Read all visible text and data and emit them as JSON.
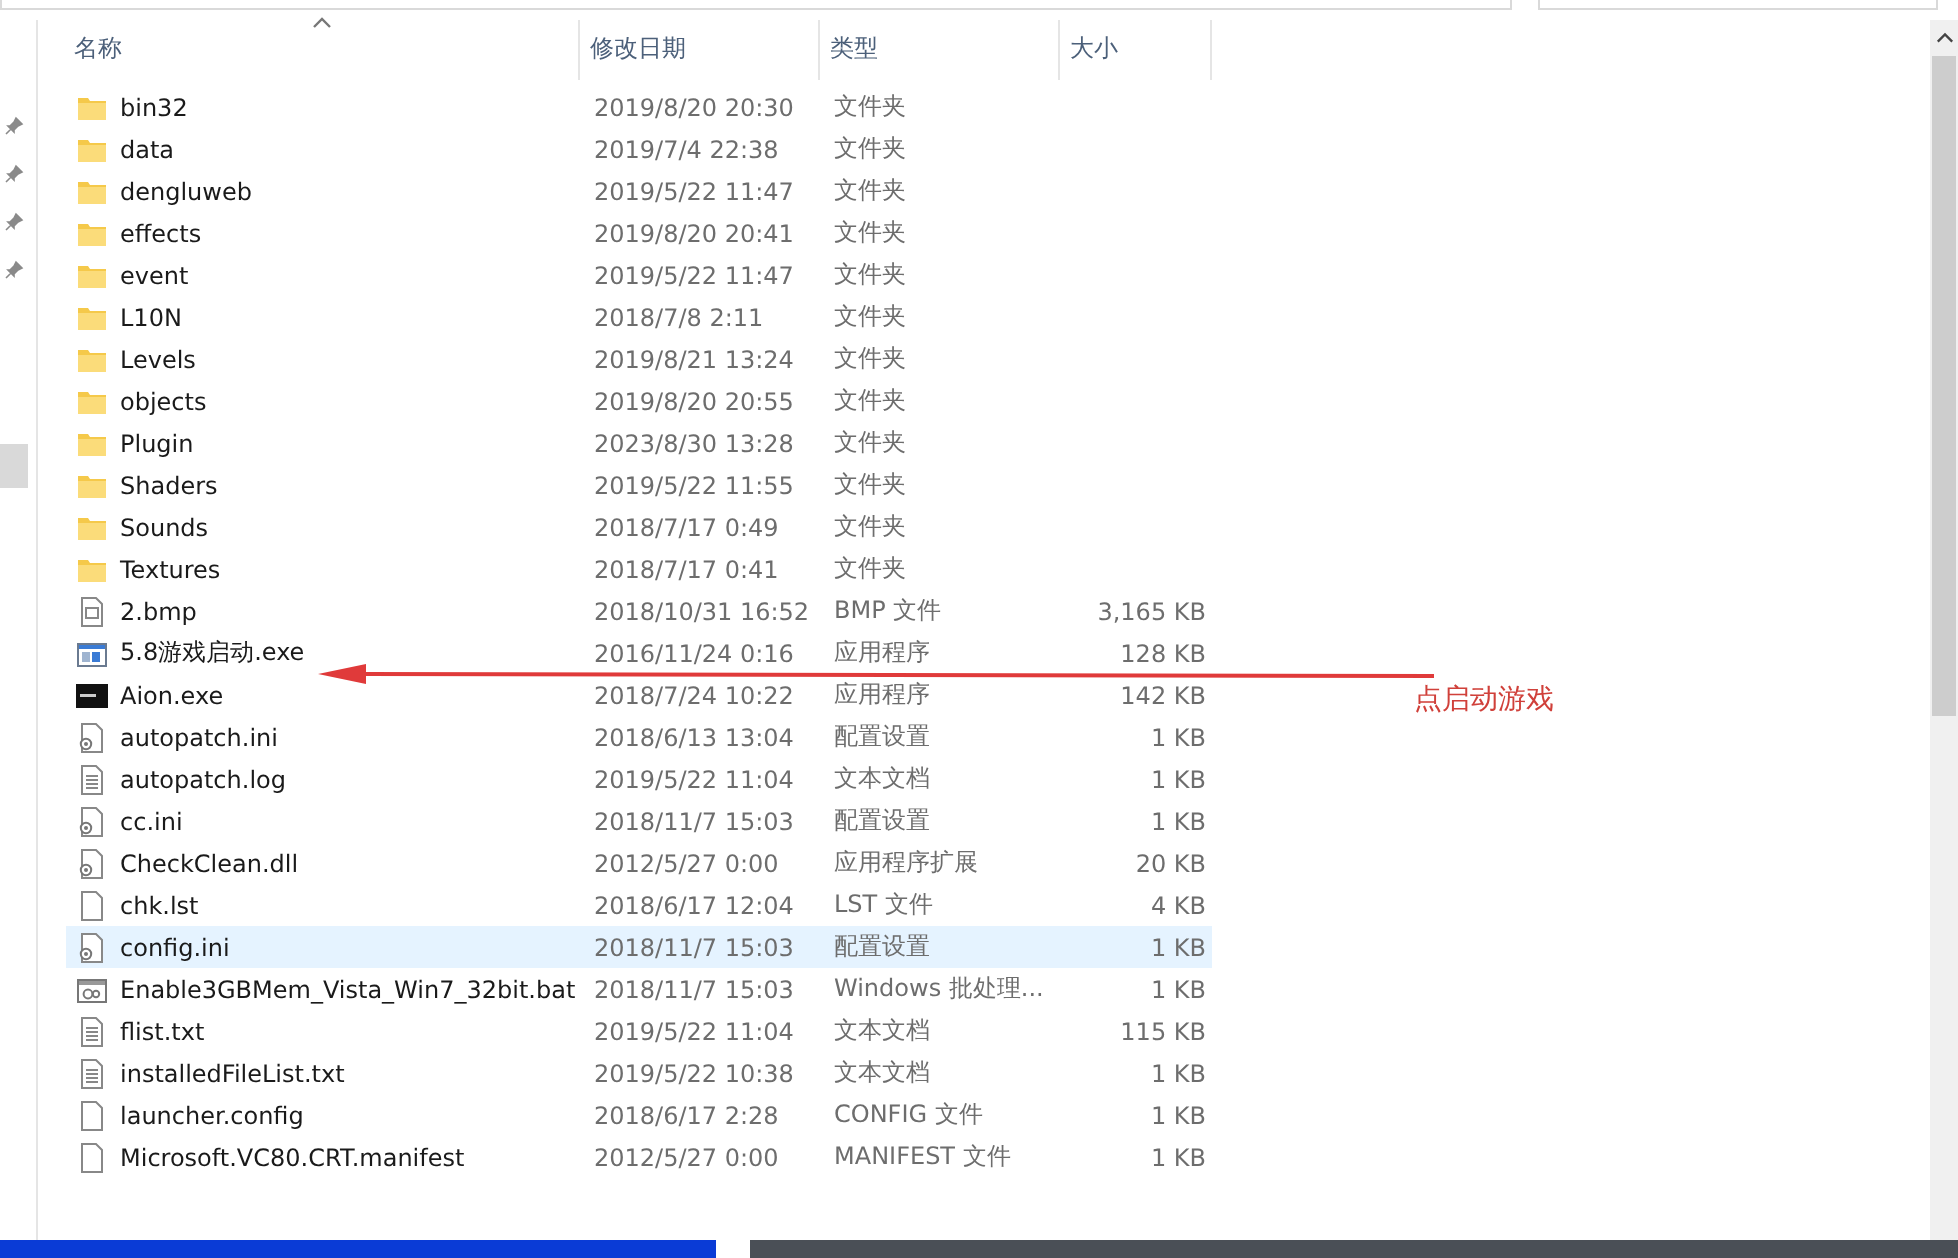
{
  "table": {
    "columns": [
      {
        "label": "名称",
        "sorted": true
      },
      {
        "label": "修改日期",
        "sorted": false
      },
      {
        "label": "类型",
        "sorted": false
      },
      {
        "label": "大小",
        "sorted": false
      }
    ],
    "rows": [
      {
        "kind": "folder",
        "name": "bin32",
        "date": "2019/8/20 20:30",
        "type": "文件夹",
        "selected": false
      },
      {
        "kind": "folder",
        "name": "data",
        "date": "2019/7/4 22:38",
        "type": "文件夹",
        "selected": false
      },
      {
        "kind": "folder",
        "name": "dengluweb",
        "date": "2019/5/22 11:47",
        "type": "文件夹",
        "selected": false
      },
      {
        "kind": "folder",
        "name": "effects",
        "date": "2019/8/20 20:41",
        "type": "文件夹",
        "selected": false
      },
      {
        "kind": "folder",
        "name": "event",
        "date": "2019/5/22 11:47",
        "type": "文件夹",
        "selected": false
      },
      {
        "kind": "folder",
        "name": "L10N",
        "date": "2018/7/8 2:11",
        "type": "文件夹",
        "selected": false
      },
      {
        "kind": "folder",
        "name": "Levels",
        "date": "2019/8/21 13:24",
        "type": "文件夹",
        "selected": false
      },
      {
        "kind": "folder",
        "name": "objects",
        "date": "2019/8/20 20:55",
        "type": "文件夹",
        "selected": false
      },
      {
        "kind": "folder",
        "name": "Plugin",
        "date": "2023/8/30 13:28",
        "type": "文件夹",
        "selected": false
      },
      {
        "kind": "folder",
        "name": "Shaders",
        "date": "2019/5/22 11:55",
        "type": "文件夹",
        "selected": false
      },
      {
        "kind": "folder",
        "name": "Sounds",
        "date": "2018/7/17 0:49",
        "type": "文件夹",
        "selected": false
      },
      {
        "kind": "folder",
        "name": "Textures",
        "date": "2018/7/17 0:41",
        "type": "文件夹",
        "selected": false
      },
      {
        "kind": "image",
        "name": "2.bmp",
        "date": "2018/10/31 16:52",
        "type": "BMP 文件",
        "size": "3,165 KB",
        "selected": false
      },
      {
        "kind": "app",
        "name": "5.8游戏启动.exe",
        "date": "2016/11/24 0:16",
        "type": "应用程序",
        "size": "128 KB",
        "selected": false
      },
      {
        "kind": "appdark",
        "name": "Aion.exe",
        "date": "2018/7/24 10:22",
        "type": "应用程序",
        "size": "142 KB",
        "selected": false
      },
      {
        "kind": "settings",
        "name": "autopatch.ini",
        "date": "2018/6/13 13:04",
        "type": "配置设置",
        "size": "1 KB",
        "selected": false
      },
      {
        "kind": "text",
        "name": "autopatch.log",
        "date": "2019/5/22 11:04",
        "type": "文本文档",
        "size": "1 KB",
        "selected": false
      },
      {
        "kind": "settings",
        "name": "cc.ini",
        "date": "2018/11/7 15:03",
        "type": "配置设置",
        "size": "1 KB",
        "selected": false
      },
      {
        "kind": "settings",
        "name": "CheckClean.dll",
        "date": "2012/5/27 0:00",
        "type": "应用程序扩展",
        "size": "20 KB",
        "selected": false
      },
      {
        "kind": "blank",
        "name": "chk.lst",
        "date": "2018/6/17 12:04",
        "type": "LST 文件",
        "size": "4 KB",
        "selected": false
      },
      {
        "kind": "settings",
        "name": "config.ini",
        "date": "2018/11/7 15:03",
        "type": "配置设置",
        "size": "1 KB",
        "selected": true
      },
      {
        "kind": "batch",
        "name": "Enable3GBMem_Vista_Win7_32bit.bat",
        "date": "2018/11/7 15:03",
        "type": "Windows 批处理...",
        "size": "1 KB",
        "selected": false
      },
      {
        "kind": "text",
        "name": "flist.txt",
        "date": "2019/5/22 11:04",
        "type": "文本文档",
        "size": "115 KB",
        "selected": false
      },
      {
        "kind": "text",
        "name": "installedFileList.txt",
        "date": "2019/5/22 10:38",
        "type": "文本文档",
        "size": "1 KB",
        "selected": false
      },
      {
        "kind": "blank",
        "name": "launcher.config",
        "date": "2018/6/17 2:28",
        "type": "CONFIG 文件",
        "size": "1 KB",
        "selected": false
      },
      {
        "kind": "blank",
        "name": "Microsoft.VC80.CRT.manifest",
        "date": "2012/5/27 0:00",
        "type": "MANIFEST 文件",
        "size": "1 KB",
        "selected": false
      }
    ]
  },
  "annotation": {
    "text": "点启动游戏"
  }
}
